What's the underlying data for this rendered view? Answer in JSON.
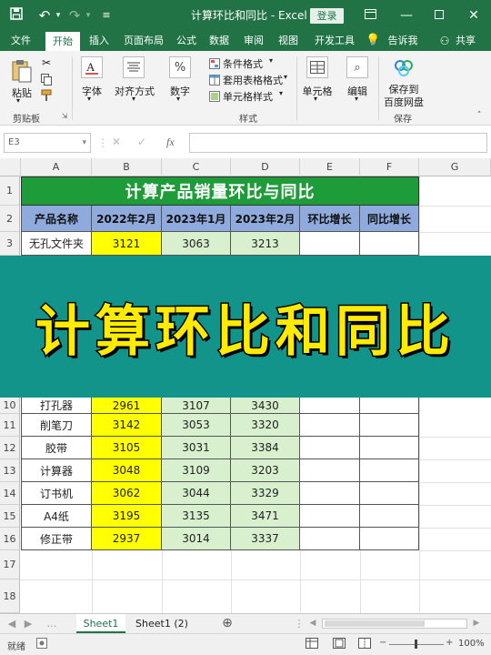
{
  "titlebar": {
    "title": "计算环比和同比  -  Excel",
    "login_label": "登录"
  },
  "tabs": [
    "文件",
    "开始",
    "插入",
    "页面布局",
    "公式",
    "数据",
    "审阅",
    "视图",
    "开发工具",
    "告诉我",
    "共享"
  ],
  "active_tab": "开始",
  "ribbon": {
    "paste_label": "粘贴",
    "clipboard_group": "剪贴板",
    "font_label": "字体",
    "align_label": "对齐方式",
    "number_label": "数字",
    "cond_format": "条件格式",
    "table_format": "套用表格格式",
    "cell_style": "单元格样式",
    "styles_group": "样式",
    "cells_label": "单元格",
    "edit_label": "编辑",
    "save_label_1": "保存到",
    "save_label_2": "百度网盘",
    "save_group": "保存"
  },
  "formula_bar": {
    "cell_ref": "E3",
    "fx_label": "fx",
    "formula_value": ""
  },
  "columns": [
    "A",
    "B",
    "C",
    "D",
    "E",
    "F",
    "G"
  ],
  "sheet": {
    "title": "计算产品销量环比与同比",
    "headers": [
      "产品名称",
      "2022年2月",
      "2023年1月",
      "2023年2月",
      "环比增长",
      "同比增长"
    ],
    "rows": [
      {
        "row": "3",
        "name": "无孔文件夹",
        "v2202": "3121",
        "v2301": "3063",
        "v2302": "3213"
      },
      {
        "row": "10",
        "name": "打孔器",
        "v2202": "2961",
        "v2301": "3107",
        "v2302": "3430"
      },
      {
        "row": "11",
        "name": "削笔刀",
        "v2202": "3142",
        "v2301": "3053",
        "v2302": "3320"
      },
      {
        "row": "12",
        "name": "胶带",
        "v2202": "3105",
        "v2301": "3031",
        "v2302": "3384"
      },
      {
        "row": "13",
        "name": "计算器",
        "v2202": "3048",
        "v2301": "3109",
        "v2302": "3203"
      },
      {
        "row": "14",
        "name": "订书机",
        "v2202": "3062",
        "v2301": "3044",
        "v2302": "3329"
      },
      {
        "row": "15",
        "name": "A4纸",
        "v2202": "3195",
        "v2301": "3135",
        "v2302": "3471"
      },
      {
        "row": "16",
        "name": "修正带",
        "v2202": "2937",
        "v2301": "3014",
        "v2302": "3337"
      }
    ],
    "header_rows": [
      "1",
      "2"
    ],
    "empty_rows": [
      "17",
      "18"
    ]
  },
  "banner": {
    "text": "计算环比和同比"
  },
  "sheet_tabs": [
    "Sheet1",
    "Sheet1 (2)"
  ],
  "status": {
    "ready": "就绪",
    "zoom": "100%"
  },
  "colors": {
    "excel_green": "#217346",
    "title_green": "#1f9c3a",
    "header_blue": "#8faadc",
    "yellow": "#ffff00",
    "light_green": "#d9f0cf",
    "banner_teal": "#13948a",
    "banner_text": "#ffeb00"
  }
}
